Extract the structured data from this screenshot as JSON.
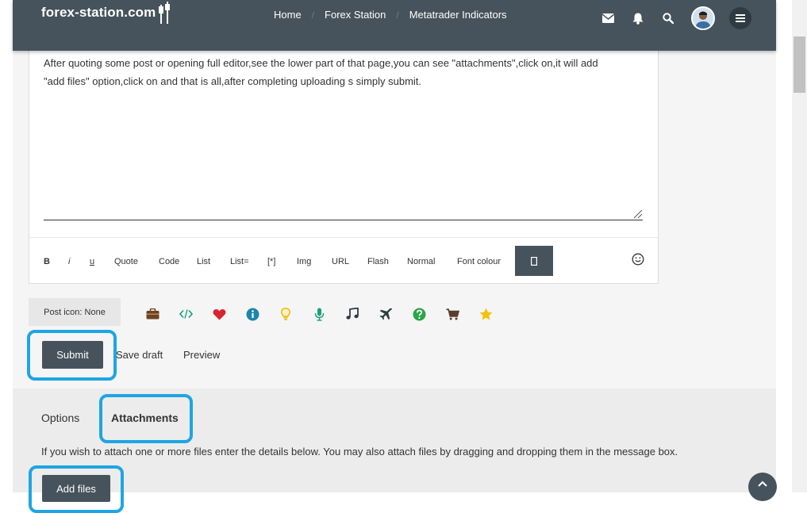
{
  "header": {
    "logo": "forex-station.com",
    "nav": [
      "Home",
      "Forex Station",
      "Metatrader Indicators"
    ]
  },
  "editor": {
    "text_line1": "After quoting some post or opening full editor,see the lower part of that page,you can see \"attachments\",click on,it will add",
    "text_line2": "\"add files\" option,click on and that is all,after completing uploading s simply submit.",
    "toolbar": {
      "bold": "B",
      "italic": "i",
      "underline": "u",
      "quote": "Quote",
      "code": "Code",
      "list": "List",
      "list_ordered": "List=",
      "list_item": "[*]",
      "img": "Img",
      "url": "URL",
      "flash": "Flash",
      "size": "Normal",
      "font_colour": "Font colour"
    }
  },
  "post_icon": {
    "label": "Post icon: None",
    "icons": [
      "briefcase-icon",
      "code-icon",
      "heart-icon",
      "info-icon",
      "lightbulb-icon",
      "microphone-icon",
      "music-icon",
      "plane-icon",
      "question-icon",
      "cart-icon",
      "star-icon"
    ]
  },
  "actions": {
    "submit": "Submit",
    "save_draft": "Save draft",
    "preview": "Preview"
  },
  "tabs": {
    "options": "Options",
    "attachments": "Attachments"
  },
  "attachments": {
    "info": "If you wish to attach one or more files enter the details below. You may also attach files by dragging and dropping them in the message box.",
    "add_files": "Add files"
  },
  "colors": {
    "header": "#46535c",
    "highlight": "#1ea5e3"
  }
}
